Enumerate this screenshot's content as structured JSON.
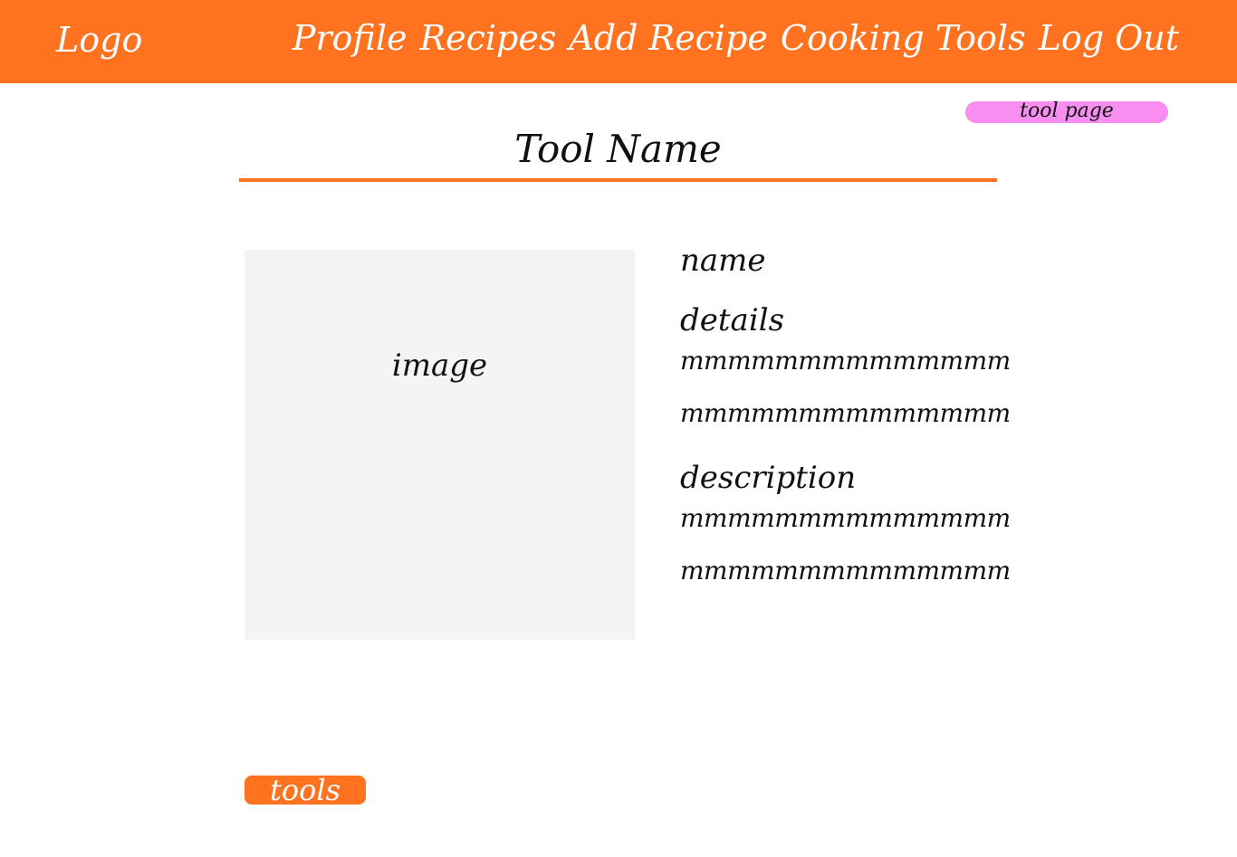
{
  "header": {
    "logo": "Logo",
    "nav": [
      "Profile",
      "Recipes",
      "Add Recipe",
      "Cooking Tools",
      "Log Out"
    ]
  },
  "page_tag": "tool page",
  "title": "Tool Name",
  "image": {
    "label": "image"
  },
  "details": {
    "name_label": "name",
    "details_label": "details",
    "details_lines": [
      "mmmmmmmmmmmmmm",
      "mmmmmmmmmmmmmm"
    ],
    "description_label": "description",
    "description_lines": [
      "mmmmmmmmmmmmmm",
      "mmmmmmmmmmmmmm"
    ]
  },
  "tools_button": "tools",
  "colors": {
    "accent": "#ff7220",
    "tag": "#f78ef0",
    "image_placeholder": "#f4f4f4"
  }
}
